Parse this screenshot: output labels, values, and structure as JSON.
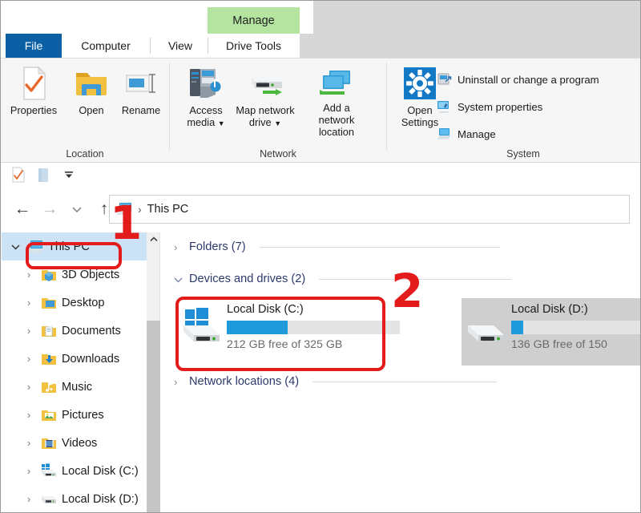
{
  "window": {
    "title": "This PC",
    "title_icon": "this-pc-icon"
  },
  "ribbon": {
    "contextual_tab": "Manage",
    "tabs": [
      {
        "label": "File",
        "active": false,
        "style": "file"
      },
      {
        "label": "Computer",
        "active": true,
        "style": "normal"
      },
      {
        "label": "View",
        "active": false,
        "style": "normal"
      },
      {
        "label": "Drive Tools",
        "active": false,
        "style": "normal"
      }
    ],
    "groups": [
      {
        "name": "Location",
        "buttons": [
          {
            "label": "Properties",
            "icon": "properties-icon"
          },
          {
            "label": "Open",
            "icon": "open-folder-icon"
          },
          {
            "label": "Rename",
            "icon": "rename-icon"
          }
        ]
      },
      {
        "name": "Network",
        "buttons": [
          {
            "label": "Access media",
            "icon": "access-media-icon",
            "dropdown": true
          },
          {
            "label": "Map network drive",
            "icon": "map-network-drive-icon",
            "dropdown": true
          },
          {
            "label": "Add a network location",
            "icon": "add-network-location-icon",
            "dropdown": false
          }
        ]
      },
      {
        "name": "System",
        "buttons": [
          {
            "label": "Open Settings",
            "icon": "settings-gear-icon"
          }
        ],
        "commands": [
          {
            "label": "Uninstall or change a program",
            "icon": "uninstall-program-icon"
          },
          {
            "label": "System properties",
            "icon": "system-properties-icon"
          },
          {
            "label": "Manage",
            "icon": "manage-computer-icon"
          }
        ]
      }
    ]
  },
  "quick_access": {
    "items": [
      {
        "icon": "properties-small-icon"
      },
      {
        "icon": "new-folder-small-icon"
      },
      {
        "icon": "customize-dropdown-icon"
      }
    ]
  },
  "address_bar": {
    "back": "←",
    "forward": "→",
    "recent": "⌄",
    "up": "↑",
    "crumb_icon": "this-pc-icon",
    "separator": "›",
    "path": "This PC"
  },
  "nav_pane": {
    "items": [
      {
        "label": "This PC",
        "icon": "this-pc-icon",
        "level": 1,
        "selected": true,
        "expanded": true
      },
      {
        "label": "3D Objects",
        "icon": "3d-objects-folder-icon",
        "level": 2,
        "selected": false,
        "expanded": false
      },
      {
        "label": "Desktop",
        "icon": "desktop-folder-icon",
        "level": 2,
        "selected": false,
        "expanded": false
      },
      {
        "label": "Documents",
        "icon": "documents-folder-icon",
        "level": 2,
        "selected": false,
        "expanded": false
      },
      {
        "label": "Downloads",
        "icon": "downloads-folder-icon",
        "level": 2,
        "selected": false,
        "expanded": false
      },
      {
        "label": "Music",
        "icon": "music-folder-icon",
        "level": 2,
        "selected": false,
        "expanded": false
      },
      {
        "label": "Pictures",
        "icon": "pictures-folder-icon",
        "level": 2,
        "selected": false,
        "expanded": false
      },
      {
        "label": "Videos",
        "icon": "videos-folder-icon",
        "level": 2,
        "selected": false,
        "expanded": false
      },
      {
        "label": "Local Disk (C:)",
        "icon": "windows-drive-icon",
        "level": 2,
        "selected": false,
        "expanded": false
      },
      {
        "label": "Local Disk (D:)",
        "icon": "hard-drive-icon",
        "level": 2,
        "selected": false,
        "expanded": false
      }
    ],
    "scrollbar": {
      "up_arrow": "⌃"
    }
  },
  "content": {
    "sections": [
      {
        "label": "Folders (7)",
        "expanded": false,
        "chevron": "›"
      },
      {
        "label": "Devices and drives (2)",
        "expanded": true,
        "chevron": "⌄"
      },
      {
        "label": "Network locations (4)",
        "expanded": false,
        "chevron": "›"
      }
    ],
    "drives": [
      {
        "name": "Local Disk (C:)",
        "free_text": "212 GB free of 325 GB",
        "used_percent": 35,
        "icon": "windows-drive-icon",
        "selected": false
      },
      {
        "name": "Local Disk (D:)",
        "free_text": "136 GB free of 150",
        "used_percent": 9,
        "icon": "hard-drive-icon",
        "selected": true
      }
    ]
  },
  "annotations": [
    {
      "number": "1",
      "target": "nav-pane-this-pc"
    },
    {
      "number": "2",
      "target": "local-disk-c-tile"
    }
  ],
  "colors": {
    "accent_blue": "#0b5fa5",
    "progress_blue": "#1f9bdc",
    "selection_blue": "#cce3f5",
    "contextual_green": "#b5e3a0",
    "annotation_red": "#e31b1b",
    "section_header": "#2b3a6b"
  }
}
